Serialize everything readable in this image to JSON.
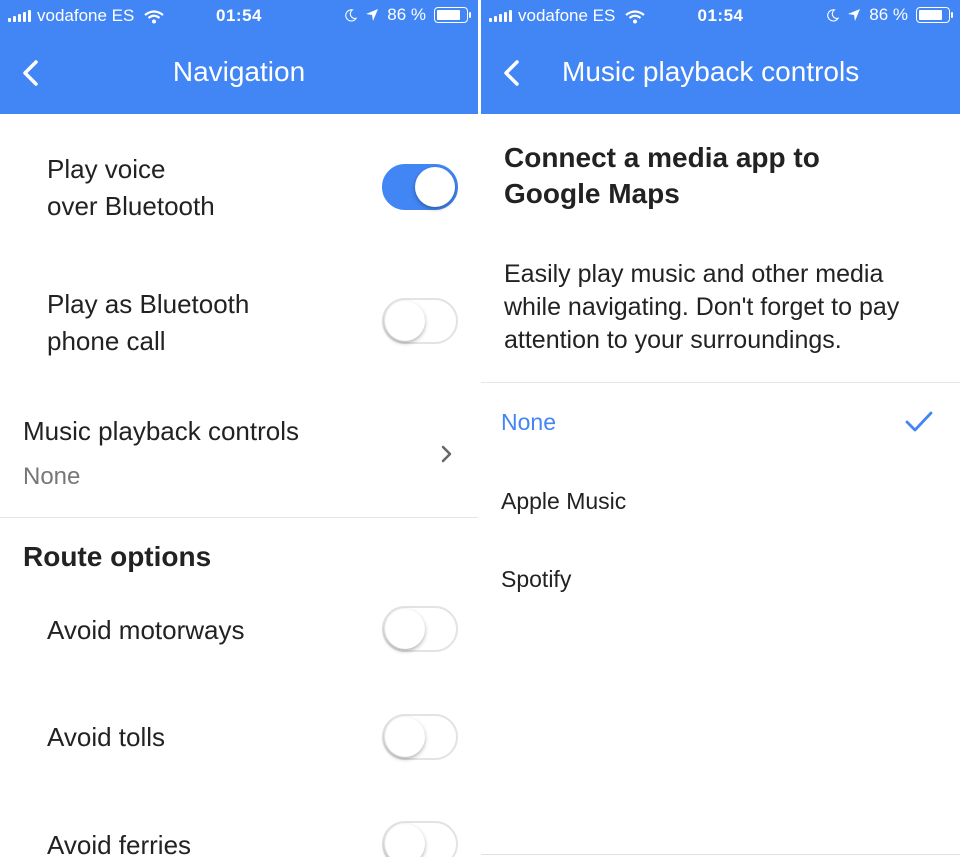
{
  "status": {
    "carrier": "vodafone ES",
    "time": "01:54",
    "battery": "86 %",
    "battery_level": 0.86
  },
  "left": {
    "title": "Navigation",
    "play_voice_line1": "Play voice",
    "play_voice_line2": "over Bluetooth",
    "play_voice_on": true,
    "play_call_line1": "Play as Bluetooth",
    "play_call_line2": "phone call",
    "play_call_on": false,
    "music_label": "Music playback controls",
    "music_value": "None",
    "route_title": "Route options",
    "avoid_motorways": "Avoid motorways",
    "avoid_tolls": "Avoid tolls",
    "avoid_ferries": "Avoid ferries"
  },
  "right": {
    "title": "Music playback controls",
    "heading": "Connect a media app to Google Maps",
    "description": "Easily play music and other media while navigating. Don't forget to pay attention to your surroundings.",
    "options": [
      {
        "label": "None",
        "selected": true
      },
      {
        "label": "Apple Music",
        "selected": false
      },
      {
        "label": "Spotify",
        "selected": false
      }
    ]
  },
  "colors": {
    "accent": "#4285f4",
    "toggle_off_border": "#e3e3e3",
    "secondary_text": "#777777"
  }
}
